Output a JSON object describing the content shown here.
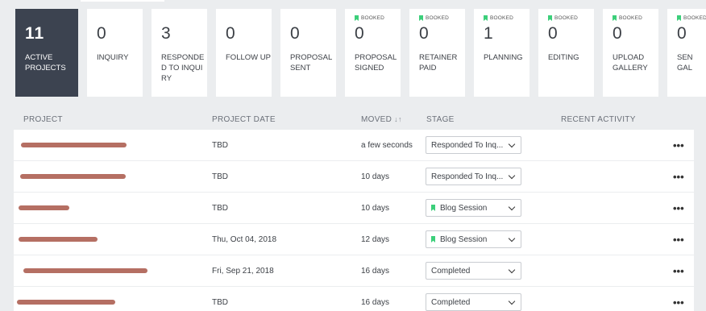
{
  "summary": {
    "count": "11",
    "label": "ACTIVE PROJECTS"
  },
  "booked_label": "BOOKED",
  "stages": [
    {
      "count": "0",
      "label": "INQUIRY",
      "booked": false
    },
    {
      "count": "3",
      "label": "RESPONDED TO INQUIRY",
      "booked": false
    },
    {
      "count": "0",
      "label": "FOLLOW UP",
      "booked": false
    },
    {
      "count": "0",
      "label": "PROPOSAL SENT",
      "booked": false
    },
    {
      "count": "0",
      "label": "PROPOSAL SIGNED",
      "booked": true
    },
    {
      "count": "0",
      "label": "RETAINER PAID",
      "booked": true
    },
    {
      "count": "1",
      "label": "PLANNING",
      "booked": true
    },
    {
      "count": "0",
      "label": "EDITING",
      "booked": true
    },
    {
      "count": "0",
      "label": "UPLOAD GALLERY",
      "booked": true
    },
    {
      "count": "0",
      "label": "SEN GAL",
      "booked": true
    }
  ],
  "table": {
    "headers": {
      "project": "PROJECT",
      "date": "PROJECT DATE",
      "moved": "MOVED",
      "stage": "STAGE",
      "activity": "RECENT ACTIVITY"
    },
    "sort_icon": "sort-icon",
    "rows": [
      {
        "date": "TBD",
        "moved": "a few seconds",
        "stage": "Responded To Inq...",
        "booked": false
      },
      {
        "date": "TBD",
        "moved": "10 days",
        "stage": "Responded To Inq...",
        "booked": false
      },
      {
        "date": "TBD",
        "moved": "10 days",
        "stage": "Blog Session",
        "booked": true
      },
      {
        "date": "Thu, Oct 04, 2018",
        "moved": "12 days",
        "stage": "Blog Session",
        "booked": true
      },
      {
        "date": "Fri, Sep 21, 2018",
        "moved": "16 days",
        "stage": "Completed",
        "booked": false
      },
      {
        "date": "TBD",
        "moved": "16 days",
        "stage": "Completed",
        "booked": false
      }
    ],
    "more_label": "•••"
  },
  "colors": {
    "active_card": "#3c4350",
    "booked_flag": "#3ccf7a",
    "redaction": "#b56f63",
    "background": "#ebedef"
  }
}
